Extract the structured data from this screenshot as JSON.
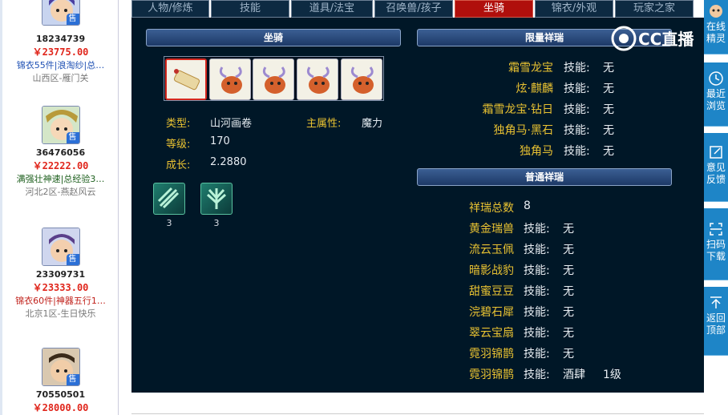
{
  "listings": [
    {
      "id": "",
      "price": "",
      "desc": "",
      "server": ""
    },
    {
      "id": "18234739",
      "price": "￥23775.00",
      "desc": "锦衣55件|浪淘纱|总…",
      "server": "山西区-雁门关"
    },
    {
      "id": "36476056",
      "price": "￥22222.00",
      "desc": "满强壮神速|总经验3…",
      "server": "河北2区-燕赵风云"
    },
    {
      "id": "23309731",
      "price": "￥23333.00",
      "desc": "锦衣60件|神器五行1…",
      "server": "北京1区-生日快乐"
    },
    {
      "id": "70550501",
      "price": "￥28000.00",
      "desc": "",
      "server": ""
    }
  ],
  "sold_badge": "售",
  "tabs": [
    "人物/修炼",
    "技能",
    "道具/法宝",
    "召唤兽/孩子",
    "坐骑",
    "锦衣/外观",
    "玩家之家"
  ],
  "mount": {
    "header": "坐骑",
    "type_label": "类型:",
    "type_value": "山河画卷",
    "attr_label": "主属性:",
    "attr_value": "魔力",
    "level_label": "等级:",
    "level_value": "170",
    "growth_label": "成长:",
    "growth_value": "2.2880",
    "skills": [
      {
        "icon": "mount-skill-1-icon",
        "level": "3"
      },
      {
        "icon": "mount-skill-2-icon",
        "level": "3"
      }
    ]
  },
  "limited": {
    "header": "限量祥瑞",
    "skill_label": "技能:",
    "items": [
      {
        "name": "霜雪龙宝",
        "skill": "无"
      },
      {
        "name": "炫·麒麟",
        "skill": "无"
      },
      {
        "name": "霜雪龙宝·钻日",
        "skill": "无"
      },
      {
        "name": "独角马·黑石",
        "skill": "无"
      },
      {
        "name": "独角马",
        "skill": "无"
      }
    ]
  },
  "normal": {
    "header": "普通祥瑞",
    "total_label": "祥瑞总数",
    "total_value": "8",
    "skill_label": "技能:",
    "items": [
      {
        "name": "黄金瑞兽",
        "skill": "无",
        "extra": ""
      },
      {
        "name": "流云玉佩",
        "skill": "无",
        "extra": ""
      },
      {
        "name": "暗影战豹",
        "skill": "无",
        "extra": ""
      },
      {
        "name": "甜蜜豆豆",
        "skill": "无",
        "extra": ""
      },
      {
        "name": "浣碧石犀",
        "skill": "无",
        "extra": ""
      },
      {
        "name": "翠云宝扇",
        "skill": "无",
        "extra": ""
      },
      {
        "name": "霓羽锦鹊",
        "skill": "无",
        "extra": ""
      },
      {
        "name": "霓羽锦鹊",
        "skill": "酒肆",
        "extra": "1级"
      }
    ]
  },
  "watermark": {
    "text": "CC直播"
  },
  "right_bar": [
    {
      "label1": "在线",
      "label2": "精灵",
      "icon": "sprite-icon"
    },
    {
      "label1": "最近",
      "label2": "浏览",
      "icon": "clock-icon"
    },
    {
      "label1": "意见",
      "label2": "反馈",
      "icon": "edit-icon"
    },
    {
      "label1": "扫码",
      "label2": "下载",
      "icon": "scan-icon"
    },
    {
      "label1": "返回",
      "label2": "顶部",
      "icon": "top-icon"
    }
  ],
  "colors": {
    "panel_bg": "#001727",
    "gold_label": "#e9c232",
    "price_red": "#e0251b",
    "active_tab": "#b00f0c",
    "side_blue": "#1e85c7"
  }
}
